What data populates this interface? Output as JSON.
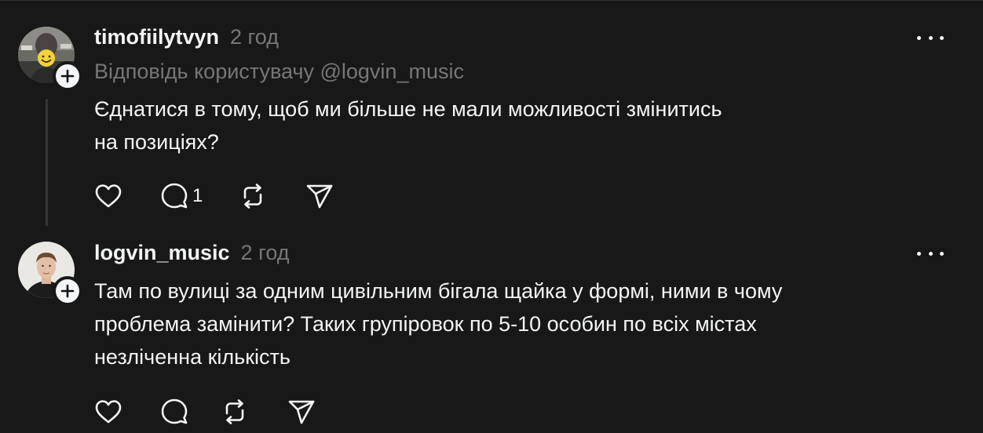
{
  "posts": [
    {
      "username": "timofiilytvyn",
      "time": "2 год",
      "reply_to": "Відповідь користувачу @logvin_music",
      "lines": [
        "Єднатися в тому, щоб ми більше не мали можливості змінитись",
        "на позиціях?"
      ],
      "reply_count": "1"
    },
    {
      "username": "logvin_music",
      "time": "2 год",
      "lines": [
        "Там по вулиці за одним цивільним бігала щайка у формі, ними в чому",
        "проблема замінити? Таких групіровок по 5-10 особин по всіх містах",
        "незліченна кількість"
      ],
      "reply_count": ""
    }
  ],
  "icons": {
    "like": "heart-icon",
    "reply": "comment-icon",
    "repost": "repost-icon",
    "share": "send-icon",
    "more": "more-icon",
    "follow": "plus-icon"
  },
  "colors": {
    "background": "#181818",
    "text": "#f3f5f7",
    "secondary": "#777777",
    "thread_line": "#333638"
  }
}
